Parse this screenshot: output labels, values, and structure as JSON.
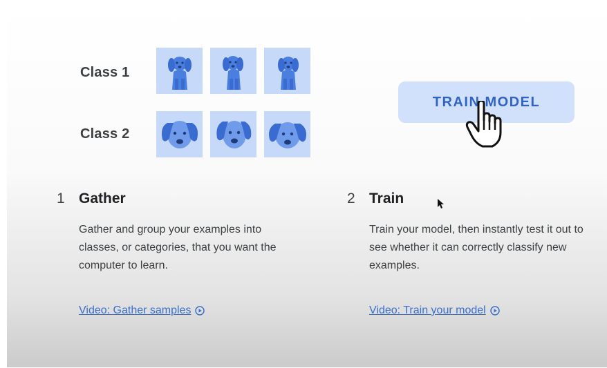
{
  "classes": [
    {
      "label": "Class 1"
    },
    {
      "label": "Class 2"
    }
  ],
  "train_button": {
    "label": "TRAIN MODEL"
  },
  "steps": [
    {
      "number": "1",
      "title": "Gather",
      "description": "Gather and group your examples into classes, or categories, that you want the computer to learn.",
      "link": "Video: Gather samples"
    },
    {
      "number": "2",
      "title": "Train",
      "description": "Train your model, then instantly test it out to see whether it can correctly classify new examples.",
      "link": "Video: Train your model"
    }
  ],
  "colors": {
    "accent": "#2f63c4",
    "button_bg": "#d2e1fb",
    "thumb_bg": "#c7d9f8",
    "dog": "#4a7fe0",
    "link": "#3b6fc9"
  },
  "icons": [
    "dog-sitting-icon",
    "dog-face-icon",
    "hand-pointer-icon",
    "arrow-pointer-icon",
    "play-circle-icon"
  ]
}
